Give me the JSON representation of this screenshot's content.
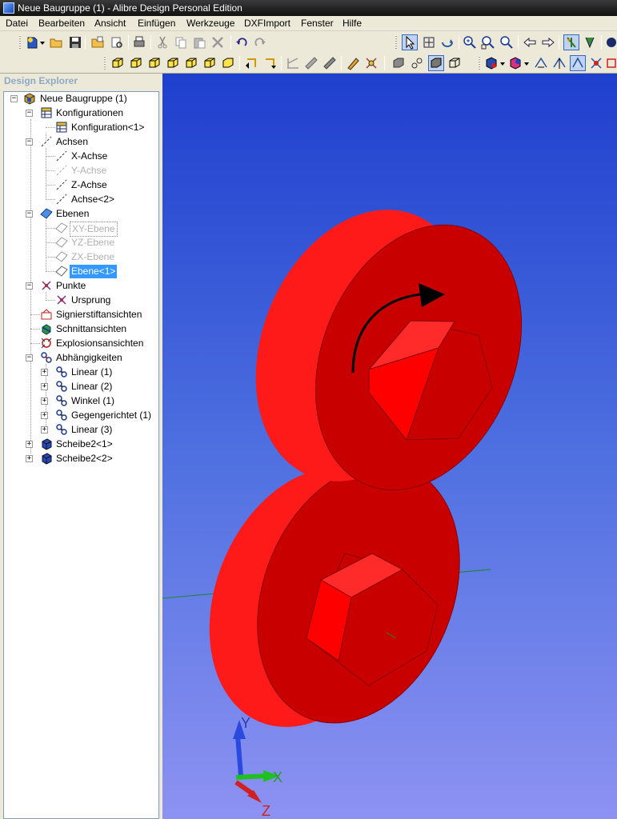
{
  "window": {
    "title": "Neue Baugruppe (1) - Alibre Design Personal Edition"
  },
  "menu": [
    "Datei",
    "Bearbeiten",
    "Ansicht",
    "Einfügen",
    "Werkzeuge",
    "DXFImport",
    "Fenster",
    "Hilfe"
  ],
  "explorer": {
    "title": "Design Explorer",
    "tree": {
      "root": "Neue Baugruppe (1)",
      "konfigurationen": "Konfigurationen",
      "konfiguration1": "Konfiguration<1>",
      "achsen": "Achsen",
      "x_achse": "X-Achse",
      "y_achse": "Y-Achse",
      "z_achse": "Z-Achse",
      "achse2": "Achse<2>",
      "ebenen": "Ebenen",
      "xy_ebene": "XY-Ebene",
      "yz_ebene": "YZ-Ebene",
      "zx_ebene": "ZX-Ebene",
      "ebene1": "Ebene<1>",
      "punkte": "Punkte",
      "ursprung": "Ursprung",
      "signierstift": "Signierstiftansichten",
      "schnitt": "Schnittansichten",
      "explosion": "Explosionsansichten",
      "abhaengigkeiten": "Abhängigkeiten",
      "linear1": "Linear (1)",
      "linear2": "Linear (2)",
      "winkel1": "Winkel (1)",
      "gegengerichtet1": "Gegengerichtet (1)",
      "linear3": "Linear (3)",
      "scheibe2_1": "Scheibe2<1>",
      "scheibe2_2": "Scheibe2<2>"
    }
  },
  "triad": {
    "x": "X",
    "y": "Y",
    "z": "Z"
  },
  "colors": {
    "part": "#ee0000",
    "part_face": "#c40000",
    "viewport_top": "#1f3fce",
    "viewport_bottom": "#8d92f2",
    "selection": "#3399ff"
  }
}
